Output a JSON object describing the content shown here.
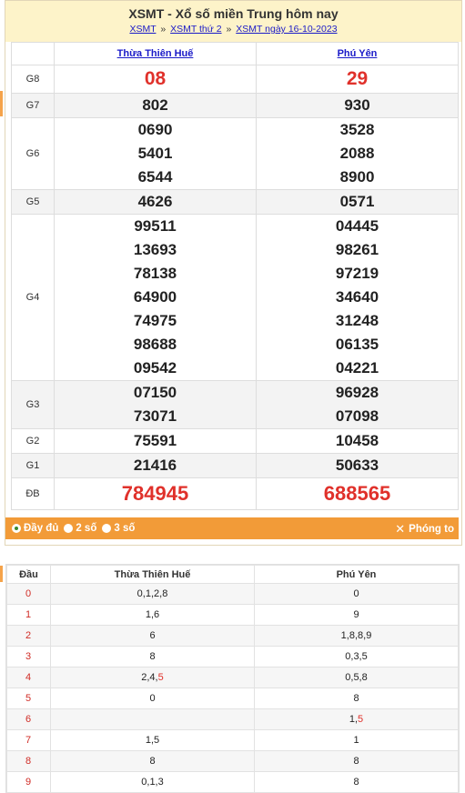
{
  "header": {
    "title": "XSMT - Xổ số miền Trung hôm nay",
    "crumb_1": "XSMT",
    "crumb_2": "XSMT thứ 2",
    "crumb_3": "XSMT ngày 16-10-2023",
    "separator": "»"
  },
  "provinces": [
    "Thừa Thiên Huế",
    "Phú Yên"
  ],
  "prizes": [
    {
      "label": "G8",
      "huế": [
        "08"
      ],
      "phu_yen": [
        "29"
      ]
    },
    {
      "label": "G7",
      "huế": [
        "802"
      ],
      "phu_yen": [
        "930"
      ]
    },
    {
      "label": "G6",
      "huế": [
        "0690",
        "5401",
        "6544"
      ],
      "phu_yen": [
        "3528",
        "2088",
        "8900"
      ]
    },
    {
      "label": "G5",
      "huế": [
        "4626"
      ],
      "phu_yen": [
        "0571"
      ]
    },
    {
      "label": "G4",
      "huế": [
        "99511",
        "13693",
        "78138",
        "64900",
        "74975",
        "98688",
        "09542"
      ],
      "phu_yen": [
        "04445",
        "98261",
        "97219",
        "34640",
        "31248",
        "06135",
        "04221"
      ]
    },
    {
      "label": "G3",
      "huế": [
        "07150",
        "73071"
      ],
      "phu_yen": [
        "96928",
        "07098"
      ]
    },
    {
      "label": "G2",
      "huế": [
        "75591"
      ],
      "phu_yen": [
        "10458"
      ]
    },
    {
      "label": "G1",
      "huế": [
        "21416"
      ],
      "phu_yen": [
        "50633"
      ]
    },
    {
      "label": "ĐB",
      "huế": [
        "784945"
      ],
      "phu_yen": [
        "688565"
      ]
    }
  ],
  "options": {
    "full": "Đầy đủ",
    "two": "2 số",
    "three": "3 số",
    "zoom": "Phóng to"
  },
  "loto": {
    "head_label": "Đầu",
    "rows": [
      {
        "dau": "0",
        "hue": "0,1,2,8",
        "phu_yen": "0"
      },
      {
        "dau": "1",
        "hue": "1,6",
        "phu_yen": "9"
      },
      {
        "dau": "2",
        "hue": "6",
        "phu_yen": "1,8,8,9"
      },
      {
        "dau": "3",
        "hue": "8",
        "phu_yen": "0,3,5"
      },
      {
        "dau": "4",
        "hue": "2,4,5",
        "phu_yen": "0,5,8"
      },
      {
        "dau": "5",
        "hue": "0",
        "phu_yen": "8"
      },
      {
        "dau": "6",
        "hue": "",
        "phu_yen": "1,5"
      },
      {
        "dau": "7",
        "hue": "1,5",
        "phu_yen": "1"
      },
      {
        "dau": "8",
        "hue": "8",
        "phu_yen": "8"
      },
      {
        "dau": "9",
        "hue": "0,1,3",
        "phu_yen": "8"
      }
    ]
  },
  "colors": {
    "accent": "#f29b38",
    "header_bg": "#fdf3c9",
    "highlight_red": "#e0312b",
    "link_blue": "#1a1ac8"
  }
}
